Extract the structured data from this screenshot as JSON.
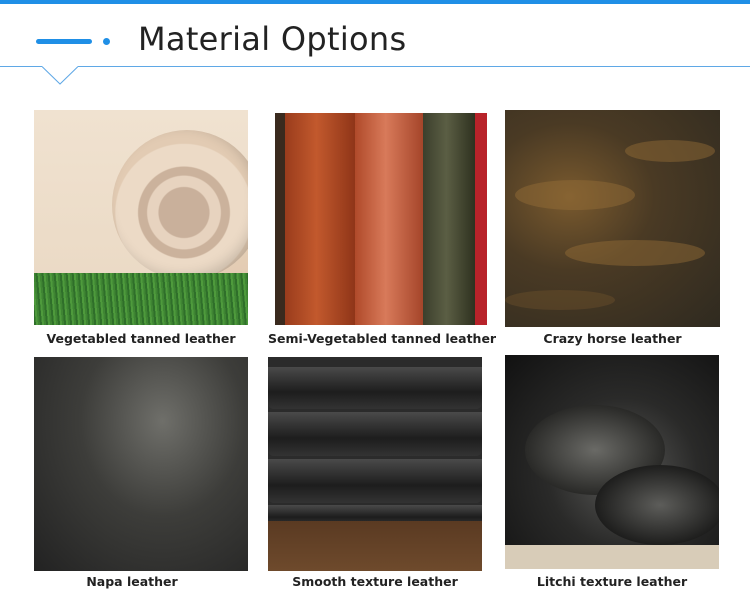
{
  "header": {
    "title": "Material Options"
  },
  "materials": [
    {
      "caption": "Vegetabled tanned leather",
      "image_icon": "leather-roll-natural"
    },
    {
      "caption": "Semi-Vegetabled tanned leather",
      "image_icon": "leather-rolls-brown"
    },
    {
      "caption": "Crazy horse leather",
      "image_icon": "leather-sheet-dark-brown"
    },
    {
      "caption": "Napa leather",
      "image_icon": "leather-sheet-black"
    },
    {
      "caption": "Smooth texture leather",
      "image_icon": "leather-rolls-black"
    },
    {
      "caption": "Litchi texture leather",
      "image_icon": "leather-fold-black"
    }
  ],
  "colors": {
    "accent": "#1f8fe6",
    "title_text": "#222222"
  }
}
